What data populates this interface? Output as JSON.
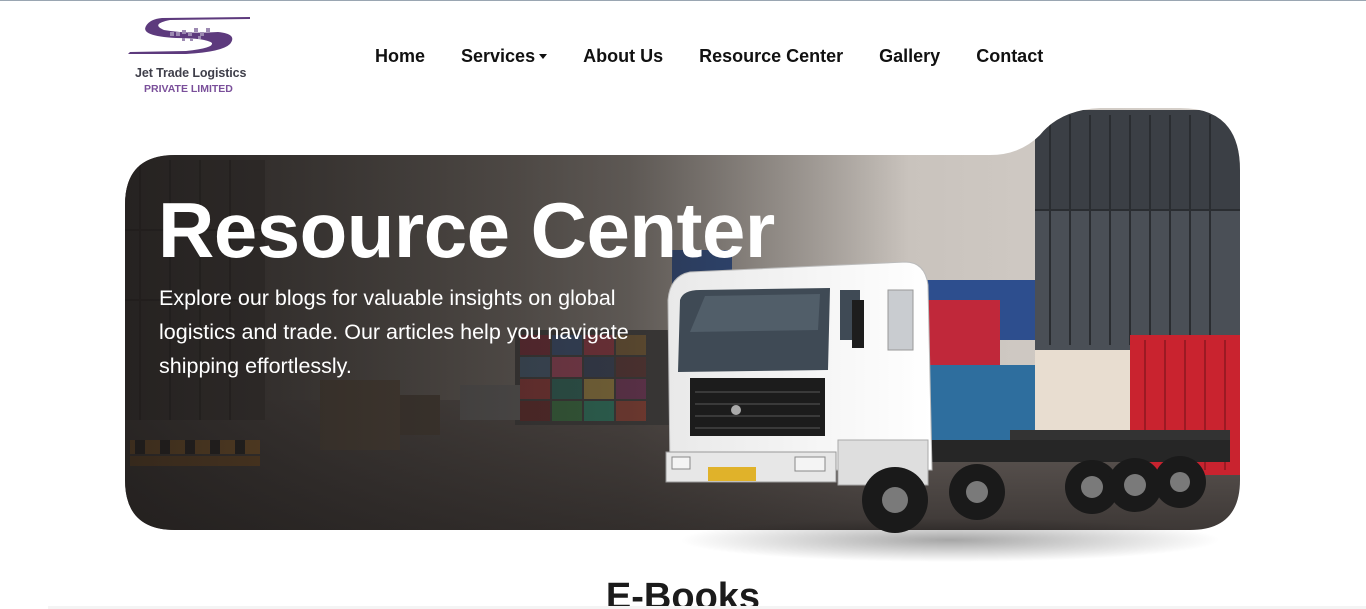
{
  "brand": {
    "name": "Jet Trade Logistics",
    "subtitle": "PRIVATE LIMITED",
    "accent_color": "#7a4f9a"
  },
  "nav": {
    "items": [
      {
        "label": "Home"
      },
      {
        "label": "Services",
        "has_dropdown": true
      },
      {
        "label": "About Us"
      },
      {
        "label": "Resource Center"
      },
      {
        "label": "Gallery"
      },
      {
        "label": "Contact"
      }
    ]
  },
  "hero": {
    "title": "Resource Center",
    "description": "Explore our blogs for valuable insights on global logistics and trade. Our articles help you navigate shipping effortlessly.",
    "image_alt": "truck-and-shipping-containers"
  },
  "sections": {
    "ebooks_title": "E-Books"
  }
}
